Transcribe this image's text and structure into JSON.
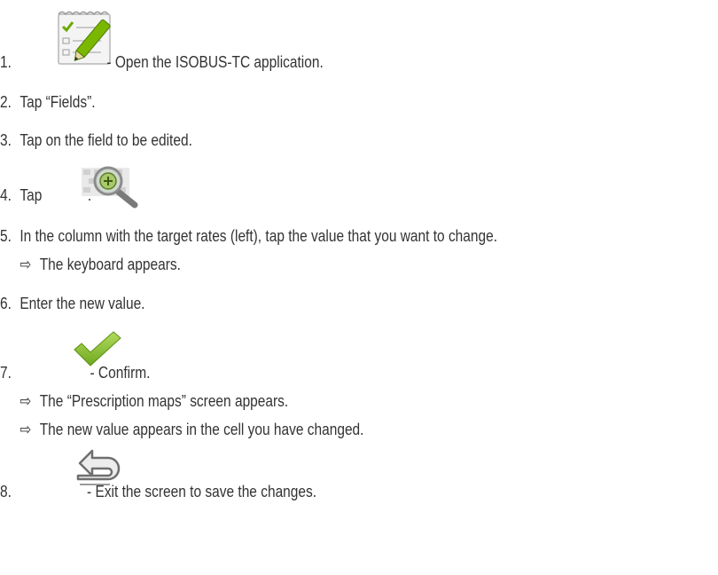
{
  "steps": [
    {
      "number": "1.",
      "text": "- Open the ISOBUS-TC application.",
      "icon": "isobus-tc-app-icon"
    },
    {
      "number": "2.",
      "text": "Tap “Fields”."
    },
    {
      "number": "3.",
      "text": "Tap on the field to be edited."
    },
    {
      "number": "4.",
      "text_before": "Tap",
      "text_after": ".",
      "icon": "zoom-map-icon"
    },
    {
      "number": "5.",
      "text": "In the column with the target rates (left), tap the value that you want to change.",
      "results": [
        "The keyboard appears."
      ]
    },
    {
      "number": "6.",
      "text": "Enter the new value."
    },
    {
      "number": "7.",
      "text": "- Confirm.",
      "icon": "checkmark-icon",
      "results": [
        "The “Prescription maps” screen appears.",
        "The new value appears in the cell you have changed."
      ]
    },
    {
      "number": "8.",
      "text": "- Exit the screen to save the changes.",
      "icon": "back-arrow-icon"
    }
  ],
  "result_arrow": "⇨",
  "colors": {
    "text": "#333333",
    "check_green": "#8cc63f",
    "pen_green": "#7ab800"
  }
}
